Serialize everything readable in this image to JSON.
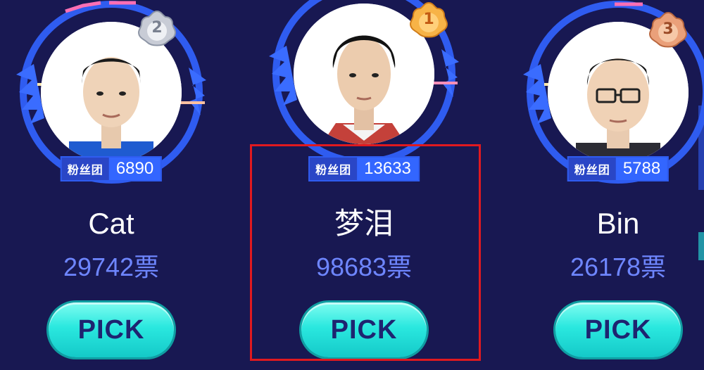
{
  "fan_badge_label": "粉丝团",
  "players": [
    {
      "rank": "2",
      "medal": "silver-medal-icon",
      "fan_count": "6890",
      "name": "Cat",
      "votes": "29742票",
      "button_label": "PICK"
    },
    {
      "rank": "1",
      "medal": "gold-medal-icon",
      "fan_count": "13633",
      "name": "梦泪",
      "votes": "98683票",
      "button_label": "PICK"
    },
    {
      "rank": "3",
      "medal": "bronze-medal-icon",
      "fan_count": "5788",
      "name": "Bin",
      "votes": "26178票",
      "button_label": "PICK"
    }
  ],
  "colors": {
    "background": "#181852",
    "ring": "#2f5cf0",
    "votes_text": "#6e86ff",
    "pick_button": "#2ae8df",
    "pick_text": "#1e2470",
    "highlight": "#e0191f",
    "gold": "#f2a23a",
    "silver": "#b9c0cc",
    "bronze": "#e2946a"
  }
}
